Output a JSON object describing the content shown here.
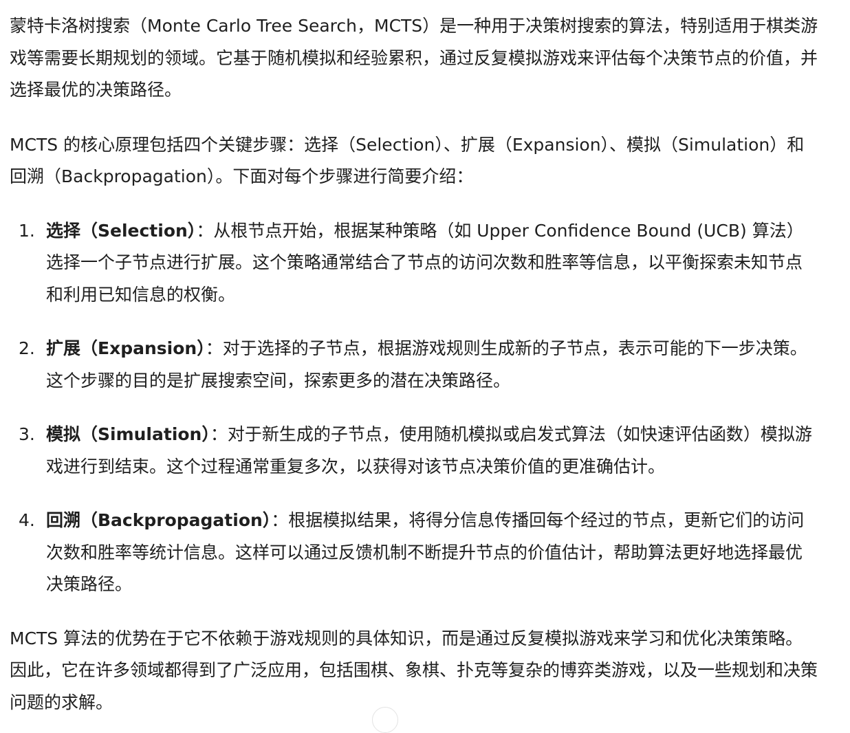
{
  "intro": {
    "p1": "蒙特卡洛树搜索（Monte Carlo Tree Search，MCTS）是一种用于决策树搜索的算法，特别适用于棋类游戏等需要长期规划的领域。它基于随机模拟和经验累积，通过反复模拟游戏来评估每个决策节点的价值，并选择最优的决策路径。",
    "p2": "MCTS 的核心原理包括四个关键步骤：选择（Selection）、扩展（Expansion）、模拟（Simulation）和回溯（Backpropagation）。下面对每个步骤进行简要介绍："
  },
  "steps": [
    {
      "number": "1.",
      "term": "选择（Selection）",
      "text": "：从根节点开始，根据某种策略（如 Upper Confidence Bound (UCB) 算法）选择一个子节点进行扩展。这个策略通常结合了节点的访问次数和胜率等信息，以平衡探索未知节点和利用已知信息的权衡。"
    },
    {
      "number": "2.",
      "term": "扩展（Expansion）",
      "text": "：对于选择的子节点，根据游戏规则生成新的子节点，表示可能的下一步决策。这个步骤的目的是扩展搜索空间，探索更多的潜在决策路径。"
    },
    {
      "number": "3.",
      "term": "模拟（Simulation）",
      "text": "：对于新生成的子节点，使用随机模拟或启发式算法（如快速评估函数）模拟游戏进行到结束。这个过程通常重复多次，以获得对该节点决策价值的更准确估计。"
    },
    {
      "number": "4.",
      "term": "回溯（Backpropagation）",
      "text": "：根据模拟结果，将得分信息传播回每个经过的节点，更新它们的访问次数和胜率等统计信息。这样可以通过反馈机制不断提升节点的价值估计，帮助算法更好地选择最优决策路径。"
    }
  ],
  "conclusion": "MCTS 算法的优势在于它不依赖于游戏规则的具体知识，而是通过反复模拟游戏来学习和优化决策策略。因此，它在许多领域都得到了广泛应用，包括围棋、象棋、扑克等复杂的博弈类游戏，以及一些规划和决策问题的求解。",
  "colors": {
    "text": "#1f1f1f",
    "background": "#ffffff"
  }
}
